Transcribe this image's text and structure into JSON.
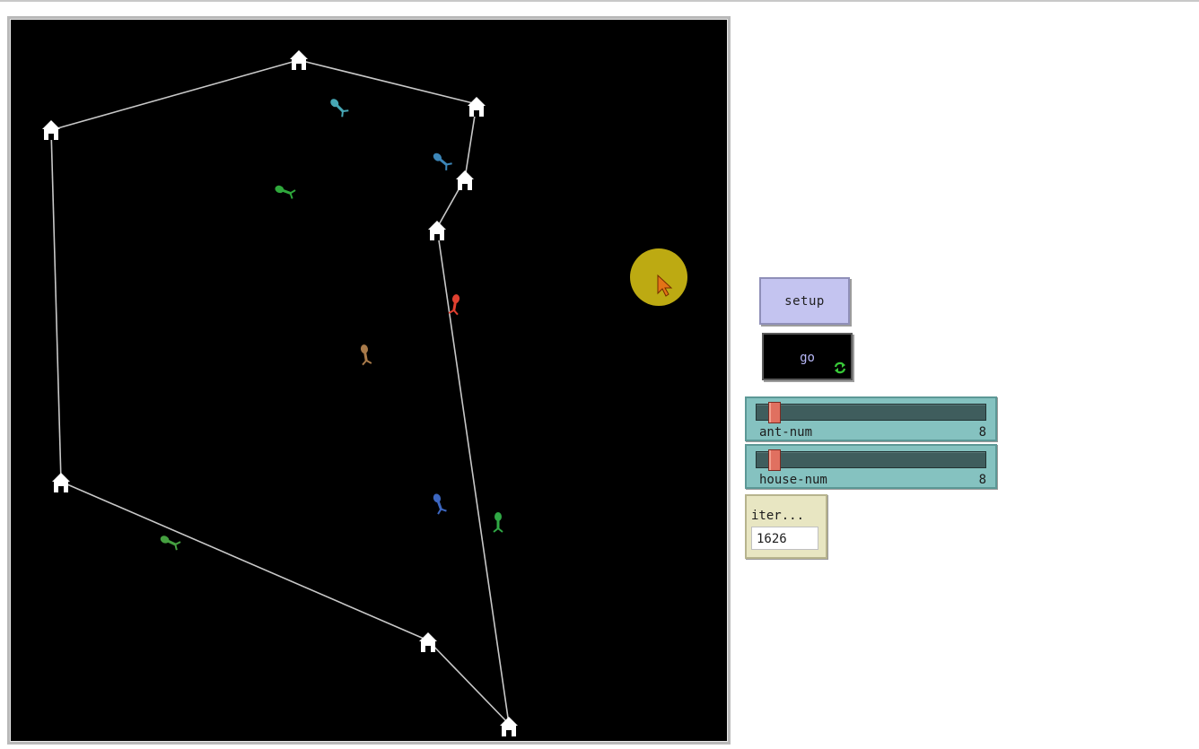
{
  "buttons": {
    "setup_label": "setup",
    "go_label": "go",
    "go_forever_icon": "forever-arrows-icon"
  },
  "sliders": [
    {
      "label": "ant-num",
      "value": "8"
    },
    {
      "label": "house-num",
      "value": "8"
    }
  ],
  "monitor": {
    "label": "iter...",
    "value": "1626"
  },
  "world": {
    "background": "#000000",
    "link_color": "#c8c8c8",
    "house_color": "#ffffff",
    "house_count": 8,
    "ant_count": 8,
    "ant_colors": [
      "#47a7b5",
      "#3c86b8",
      "#2fa83c",
      "#e04030",
      "#a87a4a",
      "#3c66c0",
      "#30a845",
      "#45a040"
    ]
  },
  "colors": {
    "setup_bg": "#c4c4f0",
    "go_bg": "#000000",
    "slider_bg": "#85c2c0",
    "slider_knob": "#e07060",
    "monitor_bg": "#e8e6c2",
    "cursor_highlight": "#c8b414"
  }
}
